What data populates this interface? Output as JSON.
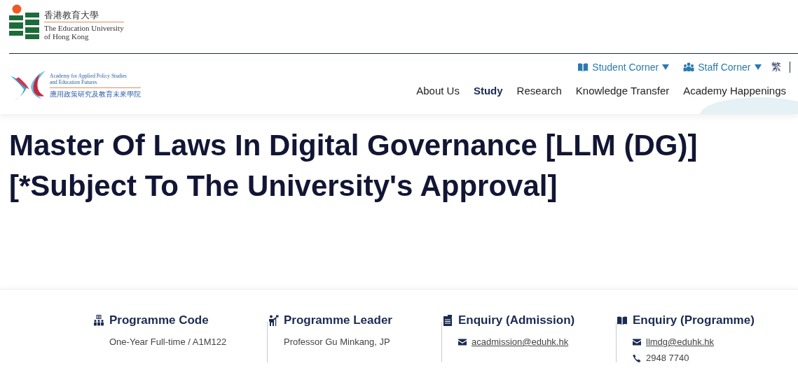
{
  "university_logo": {
    "chinese": "香港教育大學",
    "english_line_1": "The Education University",
    "english_line_2": "of Hong Kong"
  },
  "academy_logo": {
    "english_line_1": "Academy for Applied Policy Studies",
    "english_line_2": "and Education Futures",
    "chinese": "應用政策研究及教育未來學院"
  },
  "utility_links": [
    {
      "label": "Student Corner",
      "kind": "book"
    },
    {
      "label": "Staff Corner",
      "kind": "people"
    }
  ],
  "language_switch": "繁",
  "nav": [
    {
      "label": "About Us",
      "selected": false
    },
    {
      "label": "Study",
      "selected": true
    },
    {
      "label": "Research",
      "selected": false
    },
    {
      "label": "Knowledge Transfer",
      "selected": false
    },
    {
      "label": "Academy Happenings",
      "selected": false
    }
  ],
  "page_title": "Master Of Laws In Digital Governance [LLM (DG)] [*Subject To The University's Approval]",
  "info_columns": [
    {
      "kind": "code",
      "heading": "Programme Code",
      "items": [
        {
          "kind": "text",
          "text": "One-Year Full-time / A1M122"
        }
      ]
    },
    {
      "kind": "leader",
      "heading": "Programme Leader",
      "items": [
        {
          "kind": "text",
          "text": "Professor Gu Minkang, JP"
        }
      ]
    },
    {
      "kind": "admission",
      "heading": "Enquiry (Admission)",
      "items": [
        {
          "kind": "email",
          "text": "acadmission@eduhk.hk"
        }
      ]
    },
    {
      "kind": "programme",
      "heading": "Enquiry (Programme)",
      "items": [
        {
          "kind": "email",
          "text": "llmdg@eduhk.hk"
        },
        {
          "kind": "phone",
          "text": "2948 7740"
        }
      ]
    }
  ]
}
